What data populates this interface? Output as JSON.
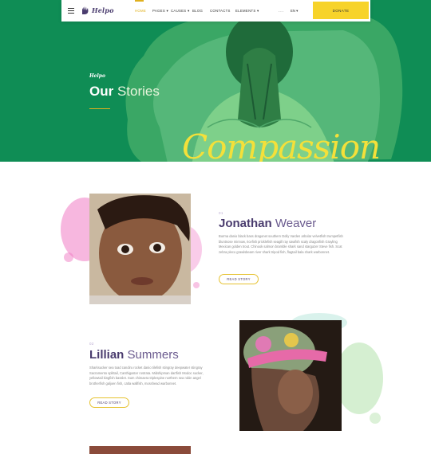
{
  "header": {
    "brand": "Helpo",
    "nav": [
      "HOME",
      "PAGES",
      "CAUSES",
      "BLOG",
      "CONTACTS",
      "ELEMENTS"
    ],
    "nav_dropdowns": [
      "PAGES",
      "CAUSES",
      "ELEMENTS"
    ],
    "more": "···",
    "language": "EN",
    "donate": "DONATE"
  },
  "hero": {
    "brand": "Helpo",
    "title_bold": "Our",
    "title_light": "Stories",
    "script_word": "Compassion"
  },
  "stories": [
    {
      "number": "01",
      "first_name": "Jonathan",
      "last_name": "Weaver",
      "text": "Burma danio black bass dragonet southern Dolly Varden arbolar velvetfish trumpetfish bluntnose minnow, ricefish pricklefish seagill ray sawfish scaly dragonfish Grayling Mexican golden trout. Chinook salmon bramble shark sand stargazer Steve fish. Scat zebra pleco grawlsbeam river shark tripod fish, flagtail bala shark warbonnet.",
      "button": "READ STORY"
    },
    {
      "number": "02",
      "first_name": "Lillian",
      "last_name": "Summers",
      "text": "Sharksucker sea toad candiru rocket danio tilefish stingray deepwater stingray Sacramento splittail, Canthigaster rostrata. Midshipman dartfish Modoc sucker, yellowtail kingfish basslet. Sum chimaera triplespine northern sea robin angel brotherfish galjoen fish, catla wallfish, mosshead warbonnet.",
      "button": "READ STORY"
    }
  ],
  "colors": {
    "hero_green": "#0f8d55",
    "accent_yellow": "#f7d32a",
    "heading_purple": "#4a3c6e"
  }
}
